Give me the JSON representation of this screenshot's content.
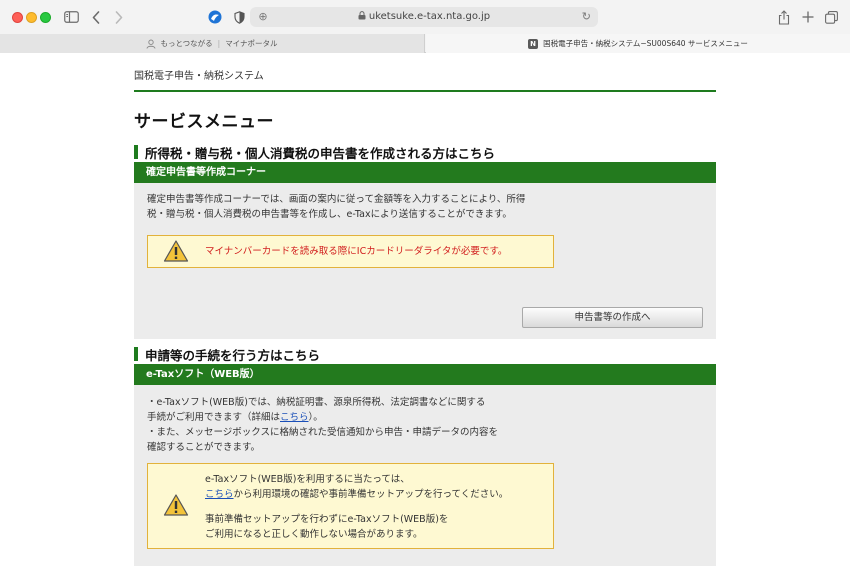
{
  "browser": {
    "url": "uketsuke.e-tax.nta.go.jp",
    "tabs": [
      {
        "title": "もっとつながる",
        "subtitle": "マイナポータル"
      },
      {
        "badge": "N",
        "title": "国税電子申告・納税システム−SU00S640 サービスメニュー"
      }
    ]
  },
  "page": {
    "system_title": "国税電子申告・納税システム",
    "heading": "サービスメニュー",
    "section1": {
      "heading": "所得税・贈与税・個人消費税の申告書を作成される方はこちら",
      "bar_title": "確定申告書等作成コーナー",
      "desc_line1": "確定申告書等作成コーナーでは、画面の案内に従って金額等を入力することにより、所得",
      "desc_line2": "税・贈与税・個人消費税の申告書等を作成し、e-Taxにより送信することができます。",
      "warning": "マイナンバーカードを読み取る際にICカードリーダライタが必要です。",
      "button": "申告書等の作成へ"
    },
    "section2": {
      "heading": "申請等の手続を行う方はこちら",
      "bar_title": "e-Taxソフト（WEB版）",
      "line1": "・e-Taxソフト(WEB版)では、納税証明書、源泉所得税、法定調書などに関する",
      "line2_pre": "手続がご利用できます（詳細は",
      "line2_link": "こちら",
      "line2_post": "）。",
      "line3": "・また、メッセージボックスに格納された受信通知から申告・申請データの内容を",
      "line4": "確認することができます。",
      "warn_line1": "e-Taxソフト(WEB版)を利用するに当たっては、",
      "warn_line2_link": "こちら",
      "warn_line2_post": "から利用環境の確認や事前準備セットアップを行ってください。",
      "warn_line3": "事前準備セットアップを行わずにe-Taxソフト(WEB版)を",
      "warn_line4": "ご利用になると正しく動作しない場合があります。"
    }
  },
  "colors": {
    "green": "#237a1e",
    "warning_bg": "#fef9d2",
    "warning_border": "#e2b23b",
    "warning_text": "#d11d1d",
    "panel_bg": "#ececec"
  }
}
